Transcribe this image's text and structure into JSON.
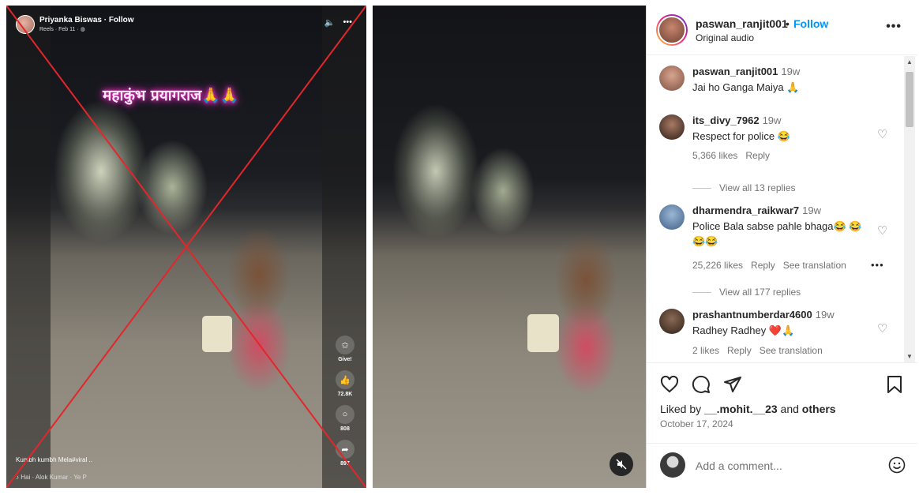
{
  "facebook_reel": {
    "user_name": "Priyanka Biswas · Follow",
    "meta": "Reels · Feb 11 · ",
    "overlay_title": "महाकुंभ प्रयागराज🙏🙏",
    "actions": [
      {
        "icon": "give-icon",
        "label": "Give!"
      },
      {
        "icon": "like-icon",
        "label": "72.8K"
      },
      {
        "icon": "comment-icon",
        "label": "808"
      },
      {
        "icon": "share-icon",
        "label": "897"
      }
    ],
    "caption": "Kumbh kumbh Mela#viral ..",
    "music": "Hai  ·  Alok Kumar · Ye P"
  },
  "instagram_post": {
    "header": {
      "username": "paswan_ranjit001",
      "separator": "•",
      "follow_label": "Follow",
      "audio": "Original audio",
      "more": "•••"
    },
    "comments": [
      {
        "username": "paswan_ranjit001",
        "time": "19w",
        "text": "Jai ho Ganga Maiya 🙏",
        "likes": "",
        "reply": "",
        "translate": "",
        "avatar_color": "#b8806a"
      },
      {
        "username": "its_divy_7962",
        "time": "19w",
        "text": "Respect for police 😂",
        "likes": "5,366 likes",
        "reply": "Reply",
        "translate": "",
        "avatar_color": "#3a2620"
      },
      {
        "username": "dharmendra_raikwar7",
        "time": "19w",
        "text": "Police Bala sabse pahle bhaga😂 😂😂😂",
        "likes": "25,226 likes",
        "reply": "Reply",
        "translate": "See translation",
        "avatar_color": "#6e8fb6"
      },
      {
        "username": "prashantnumberdar4600",
        "time": "19w",
        "text": "Radhey Radhey ❤️🙏",
        "likes": "2 likes",
        "reply": "Reply",
        "translate": "See translation",
        "avatar_color": "#4a3528"
      }
    ],
    "view_replies": [
      "View all 13 replies",
      "View all 177 replies"
    ],
    "liked_by": {
      "prefix": "Liked by ",
      "user": "__.mohit.__23",
      "middle": " and ",
      "others": "others"
    },
    "date": "October 17, 2024",
    "add_comment_placeholder": "Add a comment..."
  }
}
